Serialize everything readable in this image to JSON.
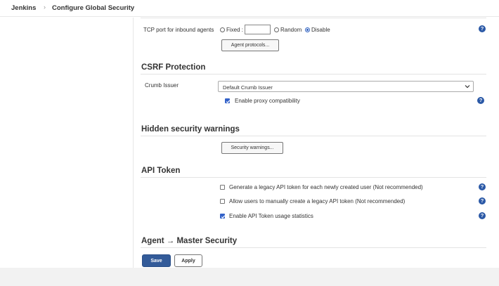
{
  "breadcrumb": {
    "home": "Jenkins",
    "separator": "›",
    "current": "Configure Global Security"
  },
  "agents": {
    "tcp_label": "TCP port for inbound agents",
    "fixed_label": "Fixed :",
    "fixed_value": "",
    "random_label": "Random",
    "disable_label": "Disable",
    "selected": "Disable",
    "protocols_button": "Agent protocols..."
  },
  "csrf": {
    "title": "CSRF Protection",
    "crumb_label": "Crumb Issuer",
    "crumb_value": "Default Crumb Issuer",
    "proxy_label": "Enable proxy compatibility",
    "proxy_checked": true
  },
  "hidden_warnings": {
    "title": "Hidden security warnings",
    "button": "Security warnings..."
  },
  "api_token": {
    "title": "API Token",
    "options": [
      {
        "label": "Generate a legacy API token for each newly created user (Not recommended)",
        "checked": false
      },
      {
        "label": "Allow users to manually create a legacy API token (Not recommended)",
        "checked": false
      },
      {
        "label": "Enable API Token usage statistics",
        "checked": true
      }
    ]
  },
  "agent_master": {
    "title": "Agent → Master Security"
  },
  "actions": {
    "save": "Save",
    "apply": "Apply"
  },
  "help_glyph": "?",
  "colors": {
    "primary": "#335b99",
    "checkbox": "#3362c9",
    "help": "#2a58a6"
  }
}
